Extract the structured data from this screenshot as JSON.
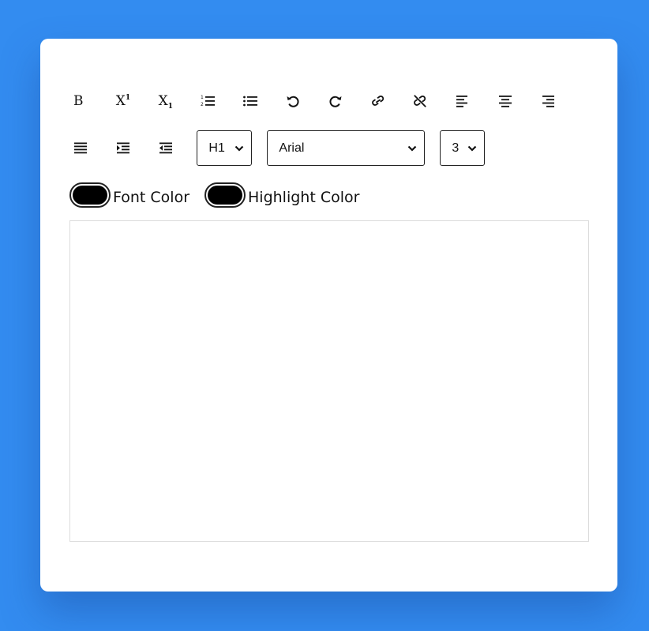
{
  "toolbar": {
    "row1": [
      {
        "name": "bold-button",
        "icon": "bold-icon",
        "label": "B"
      },
      {
        "name": "superscript-button",
        "icon": "superscript-icon",
        "label": "X",
        "mark": "1"
      },
      {
        "name": "subscript-button",
        "icon": "subscript-icon",
        "label": "X",
        "mark": "1"
      },
      {
        "name": "ordered-list-button",
        "icon": "ordered-list-icon"
      },
      {
        "name": "unordered-list-button",
        "icon": "unordered-list-icon"
      },
      {
        "name": "undo-button",
        "icon": "undo-icon"
      },
      {
        "name": "redo-button",
        "icon": "redo-icon"
      },
      {
        "name": "link-button",
        "icon": "link-icon"
      },
      {
        "name": "unlink-button",
        "icon": "unlink-icon"
      },
      {
        "name": "align-left-button",
        "icon": "align-left-icon"
      },
      {
        "name": "align-center-button",
        "icon": "align-center-icon"
      },
      {
        "name": "align-right-button",
        "icon": "align-right-icon"
      }
    ],
    "row2": [
      {
        "name": "justify-button",
        "icon": "align-justify-icon"
      },
      {
        "name": "indent-button",
        "icon": "indent-icon"
      },
      {
        "name": "outdent-button",
        "icon": "outdent-icon"
      }
    ],
    "heading_select": {
      "value": "H1"
    },
    "font_select": {
      "value": "Arial"
    },
    "size_select": {
      "value": "3"
    }
  },
  "colors": {
    "font_color_label": "Font Color",
    "font_color_value": "#000000",
    "highlight_color_label": "Highlight Color",
    "highlight_color_value": "#000000"
  },
  "editor": {
    "content": ""
  },
  "theme": {
    "background": "#338cf0",
    "card": "#ffffff"
  }
}
